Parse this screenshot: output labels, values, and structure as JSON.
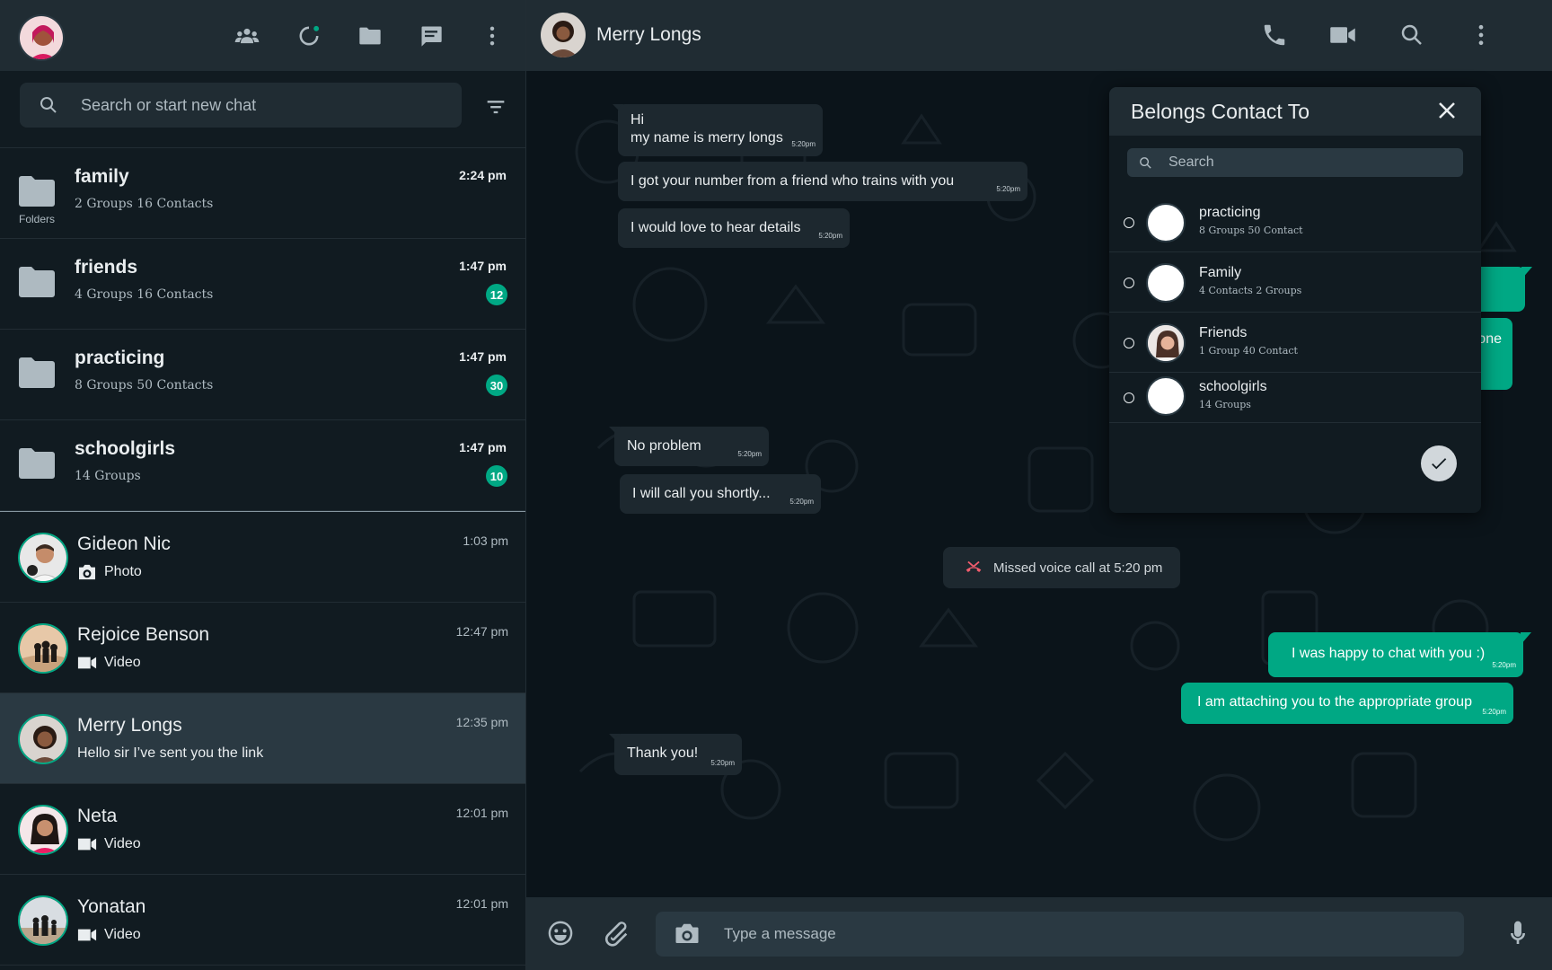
{
  "sidebar": {
    "search_placeholder": "Search or start new chat",
    "folders_label": "Folders",
    "folders": [
      {
        "name": "family",
        "meta": "2 Groups  16 Contacts",
        "time": "2:24 pm",
        "badge": ""
      },
      {
        "name": "friends",
        "meta": "4 Groups  16 Contacts",
        "time": "1:47 pm",
        "badge": "12"
      },
      {
        "name": "practicing",
        "meta": "8 Groups  50 Contacts",
        "time": "1:47 pm",
        "badge": "30"
      },
      {
        "name": "schoolgirls",
        "meta": "14 Groups",
        "time": "1:47 pm",
        "badge": "10"
      }
    ],
    "chats": [
      {
        "name": "Gideon Nic",
        "preview": "Photo",
        "preview_icon": "camera-icon",
        "time": "1:03 pm"
      },
      {
        "name": "Rejoice Benson",
        "preview": "Video",
        "preview_icon": "video-icon",
        "time": "12:47 pm"
      },
      {
        "name": "Merry Longs",
        "preview": "Hello sir I’ve sent you the link",
        "preview_icon": "",
        "time": "12:35 pm"
      },
      {
        "name": "Neta",
        "preview": "Video",
        "preview_icon": "video-icon",
        "time": "12:01 pm"
      },
      {
        "name": "Yonatan",
        "preview": "Video",
        "preview_icon": "video-icon",
        "time": "12:01 pm"
      }
    ]
  },
  "conversation": {
    "contact_name": "Merry Longs",
    "messages": [
      {
        "dir": "in",
        "text_line1": "Hi",
        "text_line2": "my name is merry longs",
        "time": "5:20pm"
      },
      {
        "dir": "in",
        "text": "I got your number from a friend who trains with you",
        "time": "5:20pm"
      },
      {
        "dir": "in",
        "text": "I would love to hear details",
        "time": "5:20pm"
      },
      {
        "dir": "out",
        "text": "one",
        "time": ""
      },
      {
        "dir": "in",
        "text": "No problem",
        "time": "5:20pm"
      },
      {
        "dir": "in",
        "text": "I will call you shortly...",
        "time": "5:20pm"
      },
      {
        "dir": "system",
        "text": "Missed voice call at 5:20 pm"
      },
      {
        "dir": "out",
        "text": "I was happy to chat with you :)",
        "time": "5:20pm"
      },
      {
        "dir": "out",
        "text": "I am attaching you to the appropriate group",
        "time": "5:20pm"
      },
      {
        "dir": "in",
        "text": "Thank you!",
        "time": "5:20pm"
      }
    ],
    "input_placeholder": "Type a message"
  },
  "popup": {
    "title": "Belongs Contact To",
    "search_placeholder": "Search",
    "items": [
      {
        "name": "practicing",
        "meta": "8 Groups 50 Contact"
      },
      {
        "name": "Family",
        "meta": "4 Contacts 2 Groups"
      },
      {
        "name": "Friends",
        "meta": "1 Group 40 Contact"
      },
      {
        "name": "schoolgirls",
        "meta": "14 Groups"
      }
    ]
  },
  "colors": {
    "accent": "#00a884",
    "panel": "#202c33",
    "background": "#111b21",
    "missed_call": "#f15c6d"
  }
}
